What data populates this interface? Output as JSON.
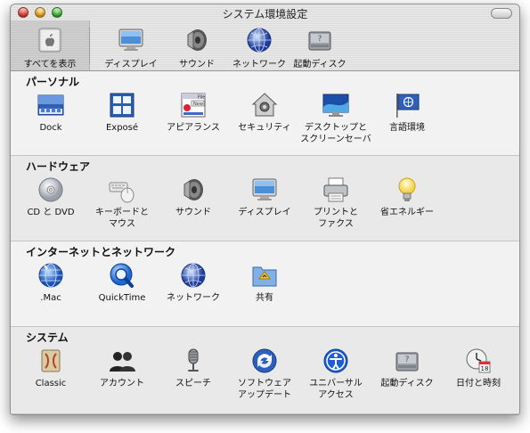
{
  "window": {
    "title": "システム環境設定"
  },
  "toolbar": {
    "items": [
      {
        "label": "すべてを表示",
        "icon": "apple-show-all-icon"
      },
      {
        "label": "ディスプレイ",
        "icon": "display-icon"
      },
      {
        "label": "サウンド",
        "icon": "speaker-icon"
      },
      {
        "label": "ネットワーク",
        "icon": "network-globe-icon"
      },
      {
        "label": "起動ディスク",
        "icon": "startup-disk-icon"
      }
    ]
  },
  "sections": [
    {
      "title": "パーソナル",
      "items": [
        {
          "label": "Dock",
          "icon": "dock-icon"
        },
        {
          "label": "Exposé",
          "icon": "expose-icon"
        },
        {
          "label": "アピアランス",
          "icon": "appearance-icon"
        },
        {
          "label": "セキュリティ",
          "icon": "security-house-icon"
        },
        {
          "label": "デスクトップと\nスクリーンセーバ",
          "icon": "desktop-screensaver-icon"
        },
        {
          "label": "言語環境",
          "icon": "international-flag-icon"
        }
      ]
    },
    {
      "title": "ハードウェア",
      "items": [
        {
          "label": "CD と DVD",
          "icon": "cd-dvd-icon"
        },
        {
          "label": "キーボードと\nマウス",
          "icon": "keyboard-mouse-icon"
        },
        {
          "label": "サウンド",
          "icon": "speaker-icon"
        },
        {
          "label": "ディスプレイ",
          "icon": "display-icon"
        },
        {
          "label": "プリントと\nファクス",
          "icon": "printer-icon"
        },
        {
          "label": "省エネルギー",
          "icon": "lightbulb-icon"
        }
      ]
    },
    {
      "title": "インターネットとネットワーク",
      "items": [
        {
          "label": ".Mac",
          "icon": "dotmac-globe-icon"
        },
        {
          "label": "QuickTime",
          "icon": "quicktime-icon"
        },
        {
          "label": "ネットワーク",
          "icon": "network-globe-icon"
        },
        {
          "label": "共有",
          "icon": "sharing-folder-icon"
        }
      ]
    },
    {
      "title": "システム",
      "items": [
        {
          "label": "Classic",
          "icon": "classic-icon"
        },
        {
          "label": "アカウント",
          "icon": "accounts-icon"
        },
        {
          "label": "スピーチ",
          "icon": "microphone-icon"
        },
        {
          "label": "ソフトウェア\nアップデート",
          "icon": "software-update-icon"
        },
        {
          "label": "ユニバーサル\nアクセス",
          "icon": "universal-access-icon"
        },
        {
          "label": "起動ディスク",
          "icon": "startup-disk-icon"
        },
        {
          "label": "日付と時刻",
          "icon": "date-time-icon"
        }
      ]
    }
  ],
  "colors": {
    "close": "#e8453c",
    "minimize": "#f2b430",
    "zoom": "#3fbf3a"
  }
}
